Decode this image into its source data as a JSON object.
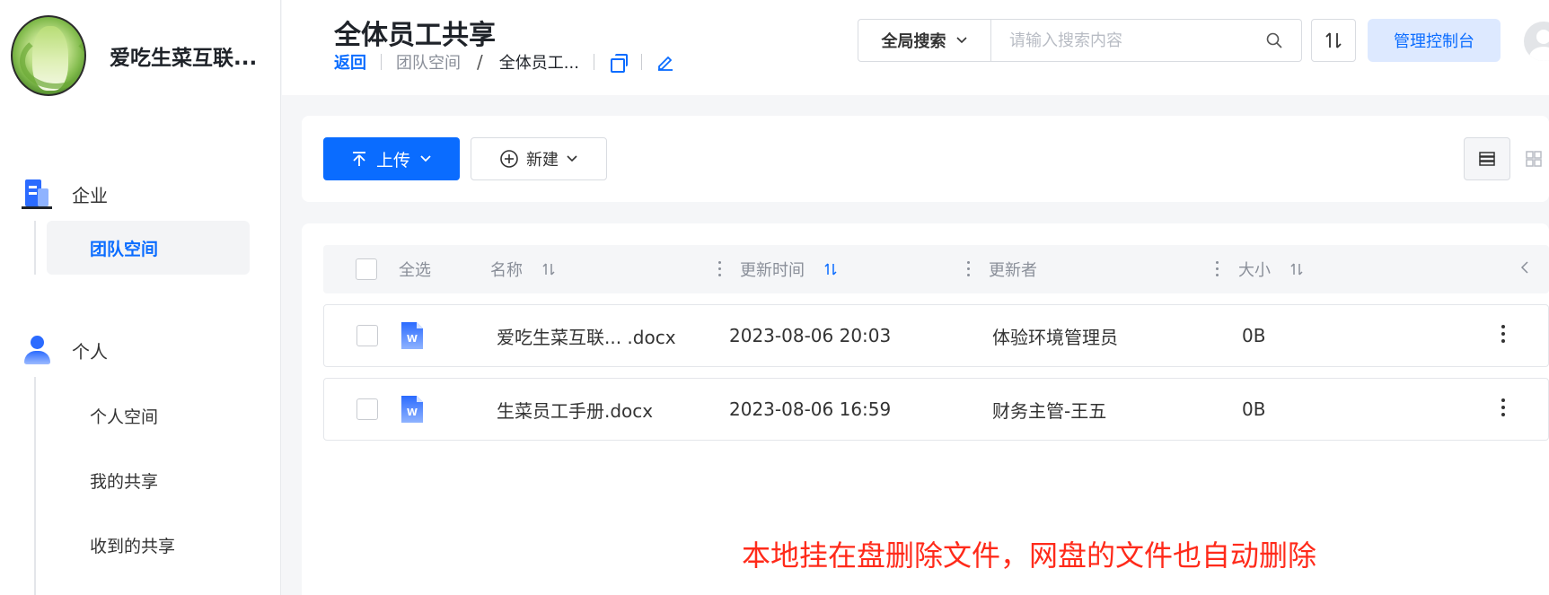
{
  "org": {
    "name": "爱吃生菜互联..."
  },
  "nav": {
    "enterprise": {
      "label": "企业",
      "items": [
        {
          "label": "团队空间",
          "active": true
        }
      ]
    },
    "personal": {
      "label": "个人",
      "items": [
        {
          "label": "个人空间"
        },
        {
          "label": "我的共享"
        },
        {
          "label": "收到的共享"
        }
      ]
    }
  },
  "header": {
    "title": "全体员工共享",
    "breadcrumb": {
      "back": "返回",
      "team": "团队空间",
      "current": "全体员工..."
    },
    "search": {
      "scope": "全局搜索",
      "placeholder": "请输入搜索内容"
    },
    "admin_label": "管理控制台"
  },
  "toolbar": {
    "upload_label": "上传",
    "new_label": "新建"
  },
  "table": {
    "select_all": "全选",
    "columns": {
      "name": "名称",
      "updated": "更新时间",
      "updater": "更新者",
      "size": "大小"
    },
    "rows": [
      {
        "name": "爱吃生菜互联... .docx",
        "updated": "2023-08-06 20:03",
        "updater": "体验环境管理员",
        "size": "0B"
      },
      {
        "name": "生菜员工手册.docx",
        "updated": "2023-08-06 16:59",
        "updater": "财务主管-王五",
        "size": "0B"
      }
    ]
  },
  "notice": "本地挂在盘删除文件，网盘的文件也自动删除",
  "colors": {
    "primary": "#0a6cff",
    "notice": "#ff2a1a",
    "admin_bg": "#dde9ff"
  }
}
